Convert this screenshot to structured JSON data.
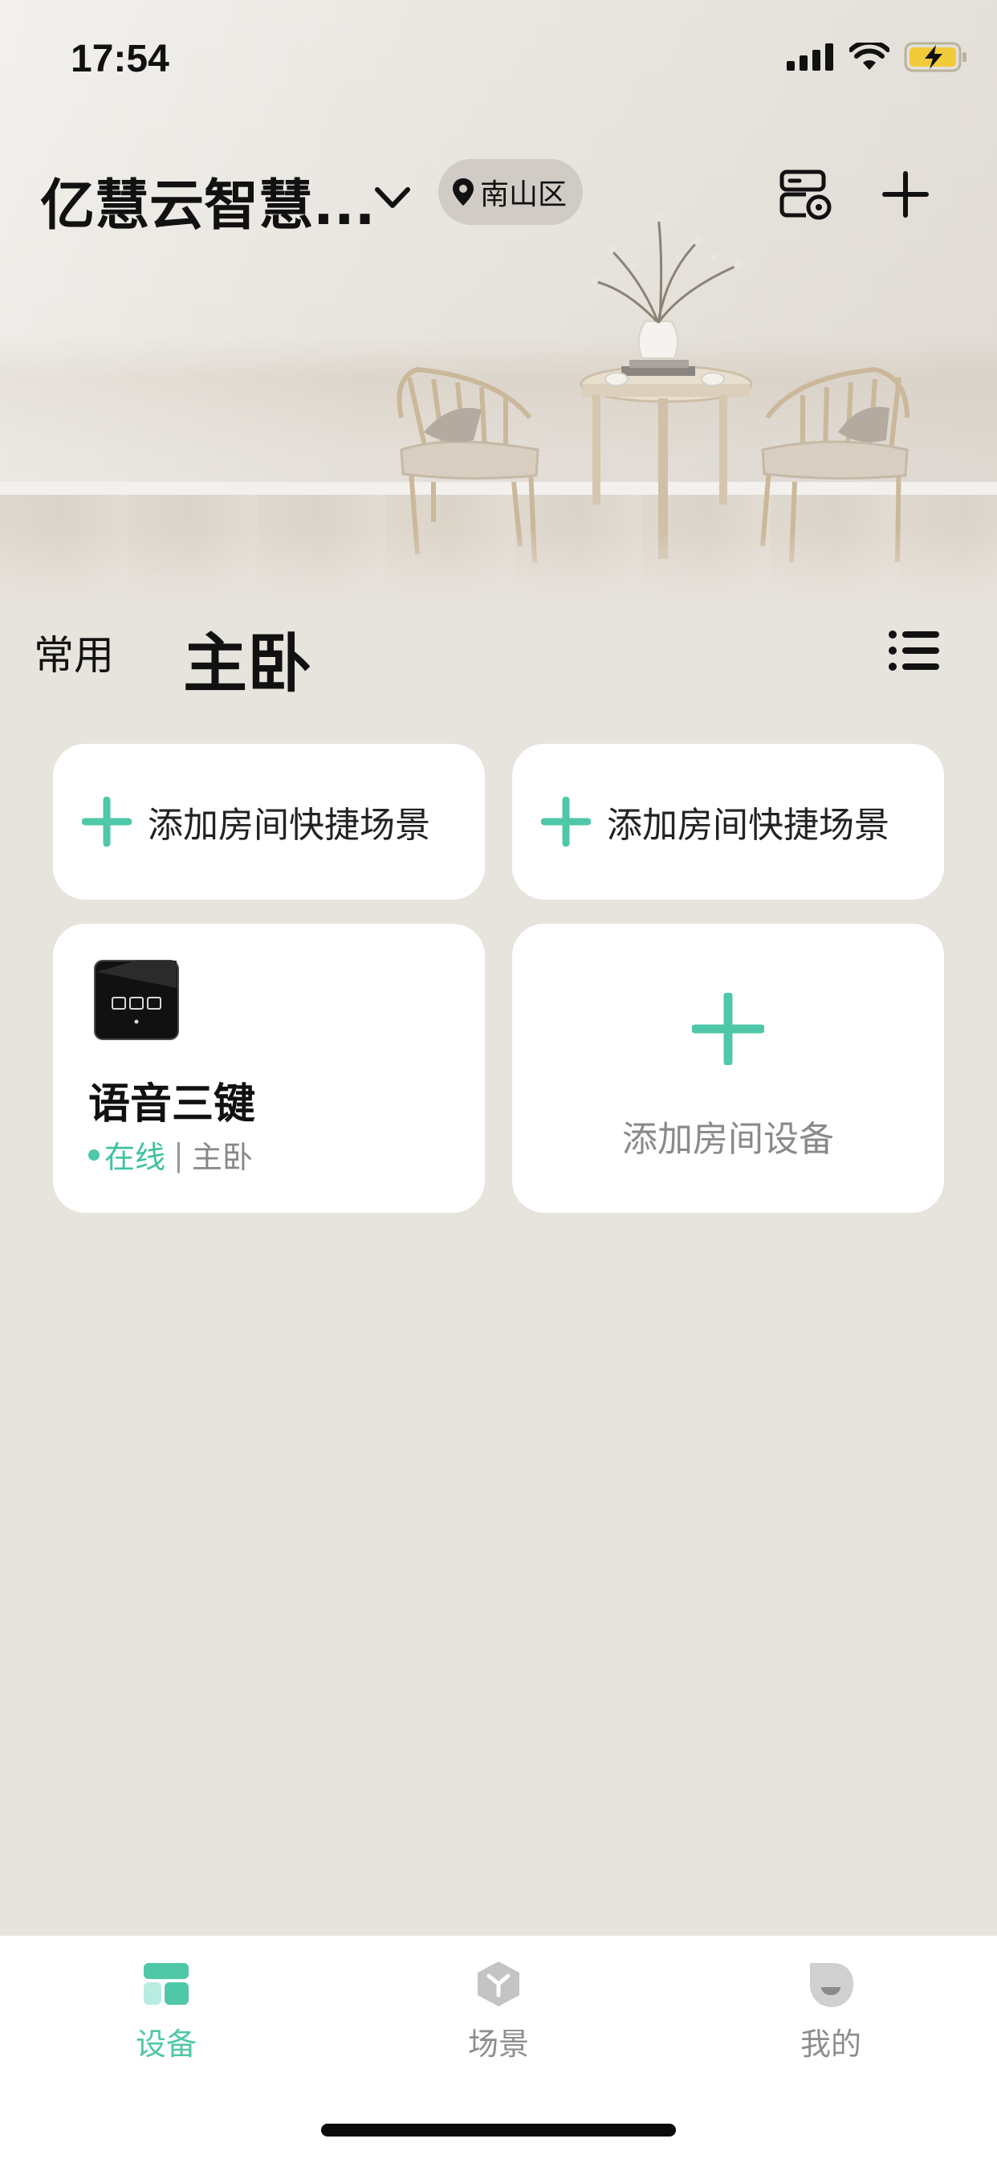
{
  "status_bar": {
    "time": "17:54",
    "icons": [
      "signal-icon",
      "wifi-icon",
      "battery-charging-icon"
    ]
  },
  "header": {
    "home_name": "亿慧云智慧...",
    "location": "南山区",
    "icons": [
      "chevron-down-icon",
      "location-pin-icon",
      "device-manage-icon",
      "add-icon"
    ]
  },
  "room_tabs": {
    "common": "常用",
    "active": "主卧",
    "menu_icon": "list-icon"
  },
  "scene_cards": [
    {
      "label": "添加房间快捷场景"
    },
    {
      "label": "添加房间快捷场景"
    }
  ],
  "device": {
    "name": "语音三键",
    "status": "在线",
    "separator": "|",
    "room": "主卧"
  },
  "add_device": {
    "label": "添加房间设备"
  },
  "tabbar": {
    "devices": "设备",
    "scenes": "场景",
    "mine": "我的"
  },
  "colors": {
    "accent": "#4fc8a8",
    "background": "#e7e3dd",
    "card": "#ffffff",
    "inactive": "#8e8e8e"
  }
}
